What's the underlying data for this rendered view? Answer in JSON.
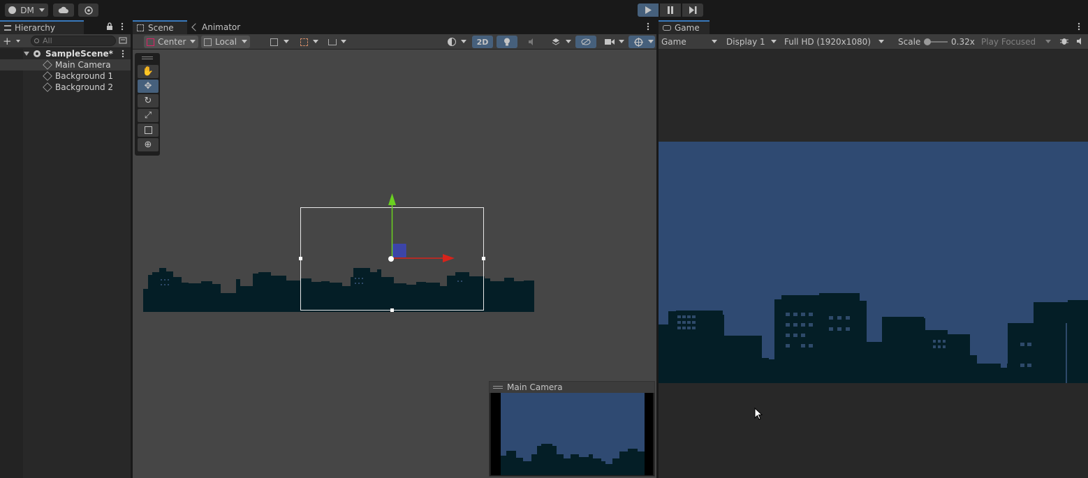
{
  "topbar": {
    "account_label": "DM",
    "cloud_icon": "cloud-icon",
    "collab_icon": "gear-icon",
    "play_icon": "play-icon",
    "pause_icon": "pause-icon",
    "step_icon": "step-icon"
  },
  "hierarchy": {
    "tab_label": "Hierarchy",
    "search_placeholder": "All",
    "add_label": "+",
    "scene_name": "SampleScene*",
    "items": [
      {
        "label": "Main Camera",
        "selected": true
      },
      {
        "label": "Background 1",
        "selected": false
      },
      {
        "label": "Background 2",
        "selected": false
      }
    ]
  },
  "scene": {
    "tab_scene": "Scene",
    "tab_animator": "Animator",
    "pivot_label": "Center",
    "space_label": "Local",
    "mode_2d_label": "2D",
    "tools": [
      "hand-tool",
      "move-tool",
      "rotate-tool",
      "scale-tool",
      "rect-tool",
      "transform-tool"
    ],
    "active_tool": "move-tool",
    "camera_preview_title": "Main Camera"
  },
  "game": {
    "tab_label": "Game",
    "view_label": "Game",
    "display_label": "Display 1",
    "resolution_label": "Full HD (1920x1080)",
    "scale_label": "Scale",
    "scale_value": "0.32x",
    "play_mode_label": "Play Focused"
  },
  "colors": {
    "sky": "#2f4a72",
    "skyline": "#041e26",
    "accent": "#46607c",
    "selection_blue": "#3a79bb"
  }
}
